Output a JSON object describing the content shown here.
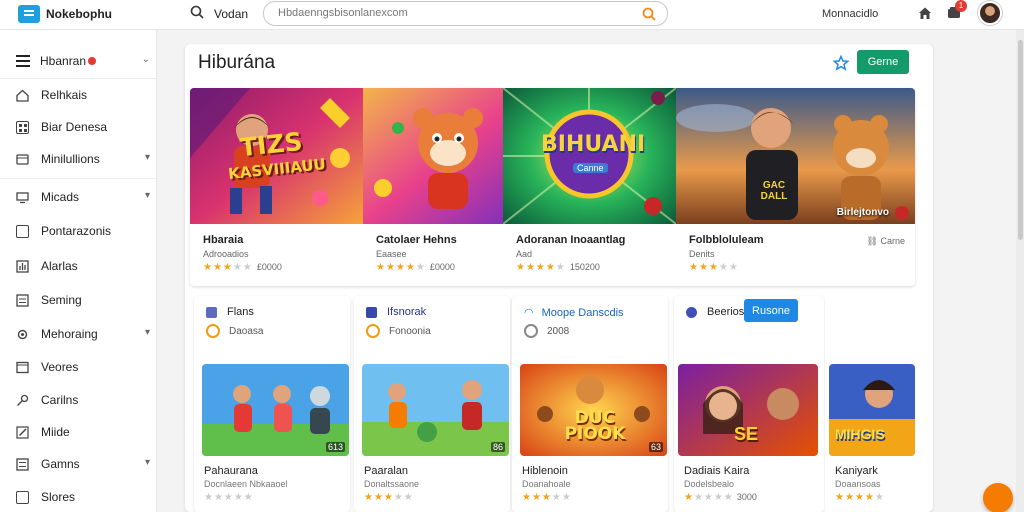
{
  "header": {
    "logo_text": "Nokebophu",
    "nav_link": "Vodan",
    "search_placeholder": "Hbdaenngsbisonlanexcom",
    "account_link": "Monnacidlo",
    "notifications_count": "1"
  },
  "sidebar": {
    "menu_title": "Hbanran",
    "items": [
      {
        "label": "Relhkais",
        "icon": "home-outline-icon",
        "chevron": false
      },
      {
        "label": "Biar Denesa",
        "icon": "grid-icon",
        "chevron": false
      },
      {
        "label": "Minilullions",
        "icon": "film-icon",
        "chevron": true
      },
      {
        "label": "Micads",
        "icon": "monitor-icon",
        "chevron": true
      },
      {
        "label": "Pontarazonis",
        "icon": "tablet-icon",
        "chevron": false
      },
      {
        "label": "Alarlas",
        "icon": "chart-icon",
        "chevron": false
      },
      {
        "label": "Seming",
        "icon": "sliders-icon",
        "chevron": false
      },
      {
        "label": "Mehoraing",
        "icon": "gear-icon",
        "chevron": true
      },
      {
        "label": "Veores",
        "icon": "window-icon",
        "chevron": false
      },
      {
        "label": "Carilns",
        "icon": "key-icon",
        "chevron": false
      },
      {
        "label": "Miide",
        "icon": "pencil-icon",
        "chevron": false
      },
      {
        "label": "Gamns",
        "icon": "list-icon",
        "chevron": true
      },
      {
        "label": "Slores",
        "icon": "square-icon",
        "chevron": false
      }
    ]
  },
  "main": {
    "page_title": "Hiburána",
    "games_button": "Gerne",
    "featured": [
      {
        "title": "Hbaraia",
        "subtitle": "Adrooadios",
        "rating": 3.5,
        "count": "£0000",
        "overlay_text": ""
      },
      {
        "title": "Catolaer Hehns",
        "subtitle": "Eaasee",
        "rating": 4,
        "count": "£0000",
        "overlay_text": ""
      },
      {
        "title": "Adoranan Inoaantlag",
        "subtitle": "Aad",
        "rating": 4.5,
        "count": "150200",
        "overlay_text": ""
      },
      {
        "title": "Folbbloluleam",
        "subtitle": "Denits",
        "rating": 3,
        "count": "",
        "tag": "Carne",
        "overlay_text": "Birlejtonvo"
      }
    ],
    "image_texts": {
      "feature1_big": "TIZS",
      "feature1_line": "KASVIIIAUU",
      "feature3_big": "BIHUANI",
      "feature3_small": "Canne",
      "feature4_shirt": "GAC DALL"
    },
    "tab_pill": "Rusone",
    "grid": [
      {
        "head": "Flans",
        "sub": "Daoasa",
        "title": "Pahaurana",
        "meta": "Docnlaeen Nbkaaoel",
        "rating": 0,
        "count": "",
        "num": "613",
        "head_color": "#5c6bc0"
      },
      {
        "head": "Ifsnorak",
        "sub": "Fonoonia",
        "title": "Paaralan",
        "meta": "Donaltssaone",
        "rating": 3.5,
        "count": "",
        "num": "86",
        "head_color": "#3949ab"
      },
      {
        "head": "Moope Danscdis",
        "sub": "2008",
        "title": "Hiblenoin",
        "meta": "Doanahoale",
        "rating": 3,
        "count": "",
        "num": "63",
        "head_color": "#1e88e5",
        "img_text": "DUC PIOOK"
      },
      {
        "head": "Beerios",
        "sub": "",
        "title": "Dadiais Kaira",
        "meta": "Dodelsbealo",
        "rating": 1,
        "count": "3000",
        "num": "",
        "head_color": "#3f51b5",
        "img_text": "SE"
      },
      {
        "head": "",
        "sub": "",
        "title": "Kaniyark",
        "meta": "Doaansoas",
        "rating": 4,
        "count": "",
        "num": "",
        "head_color": "#999",
        "img_text": "MIHGIS"
      }
    ]
  },
  "colors": {
    "accent_green": "#159a6b",
    "accent_blue": "#1e88e5",
    "star": "#f2a516",
    "badge_red": "#e53935",
    "fab_orange": "#f57c00"
  }
}
